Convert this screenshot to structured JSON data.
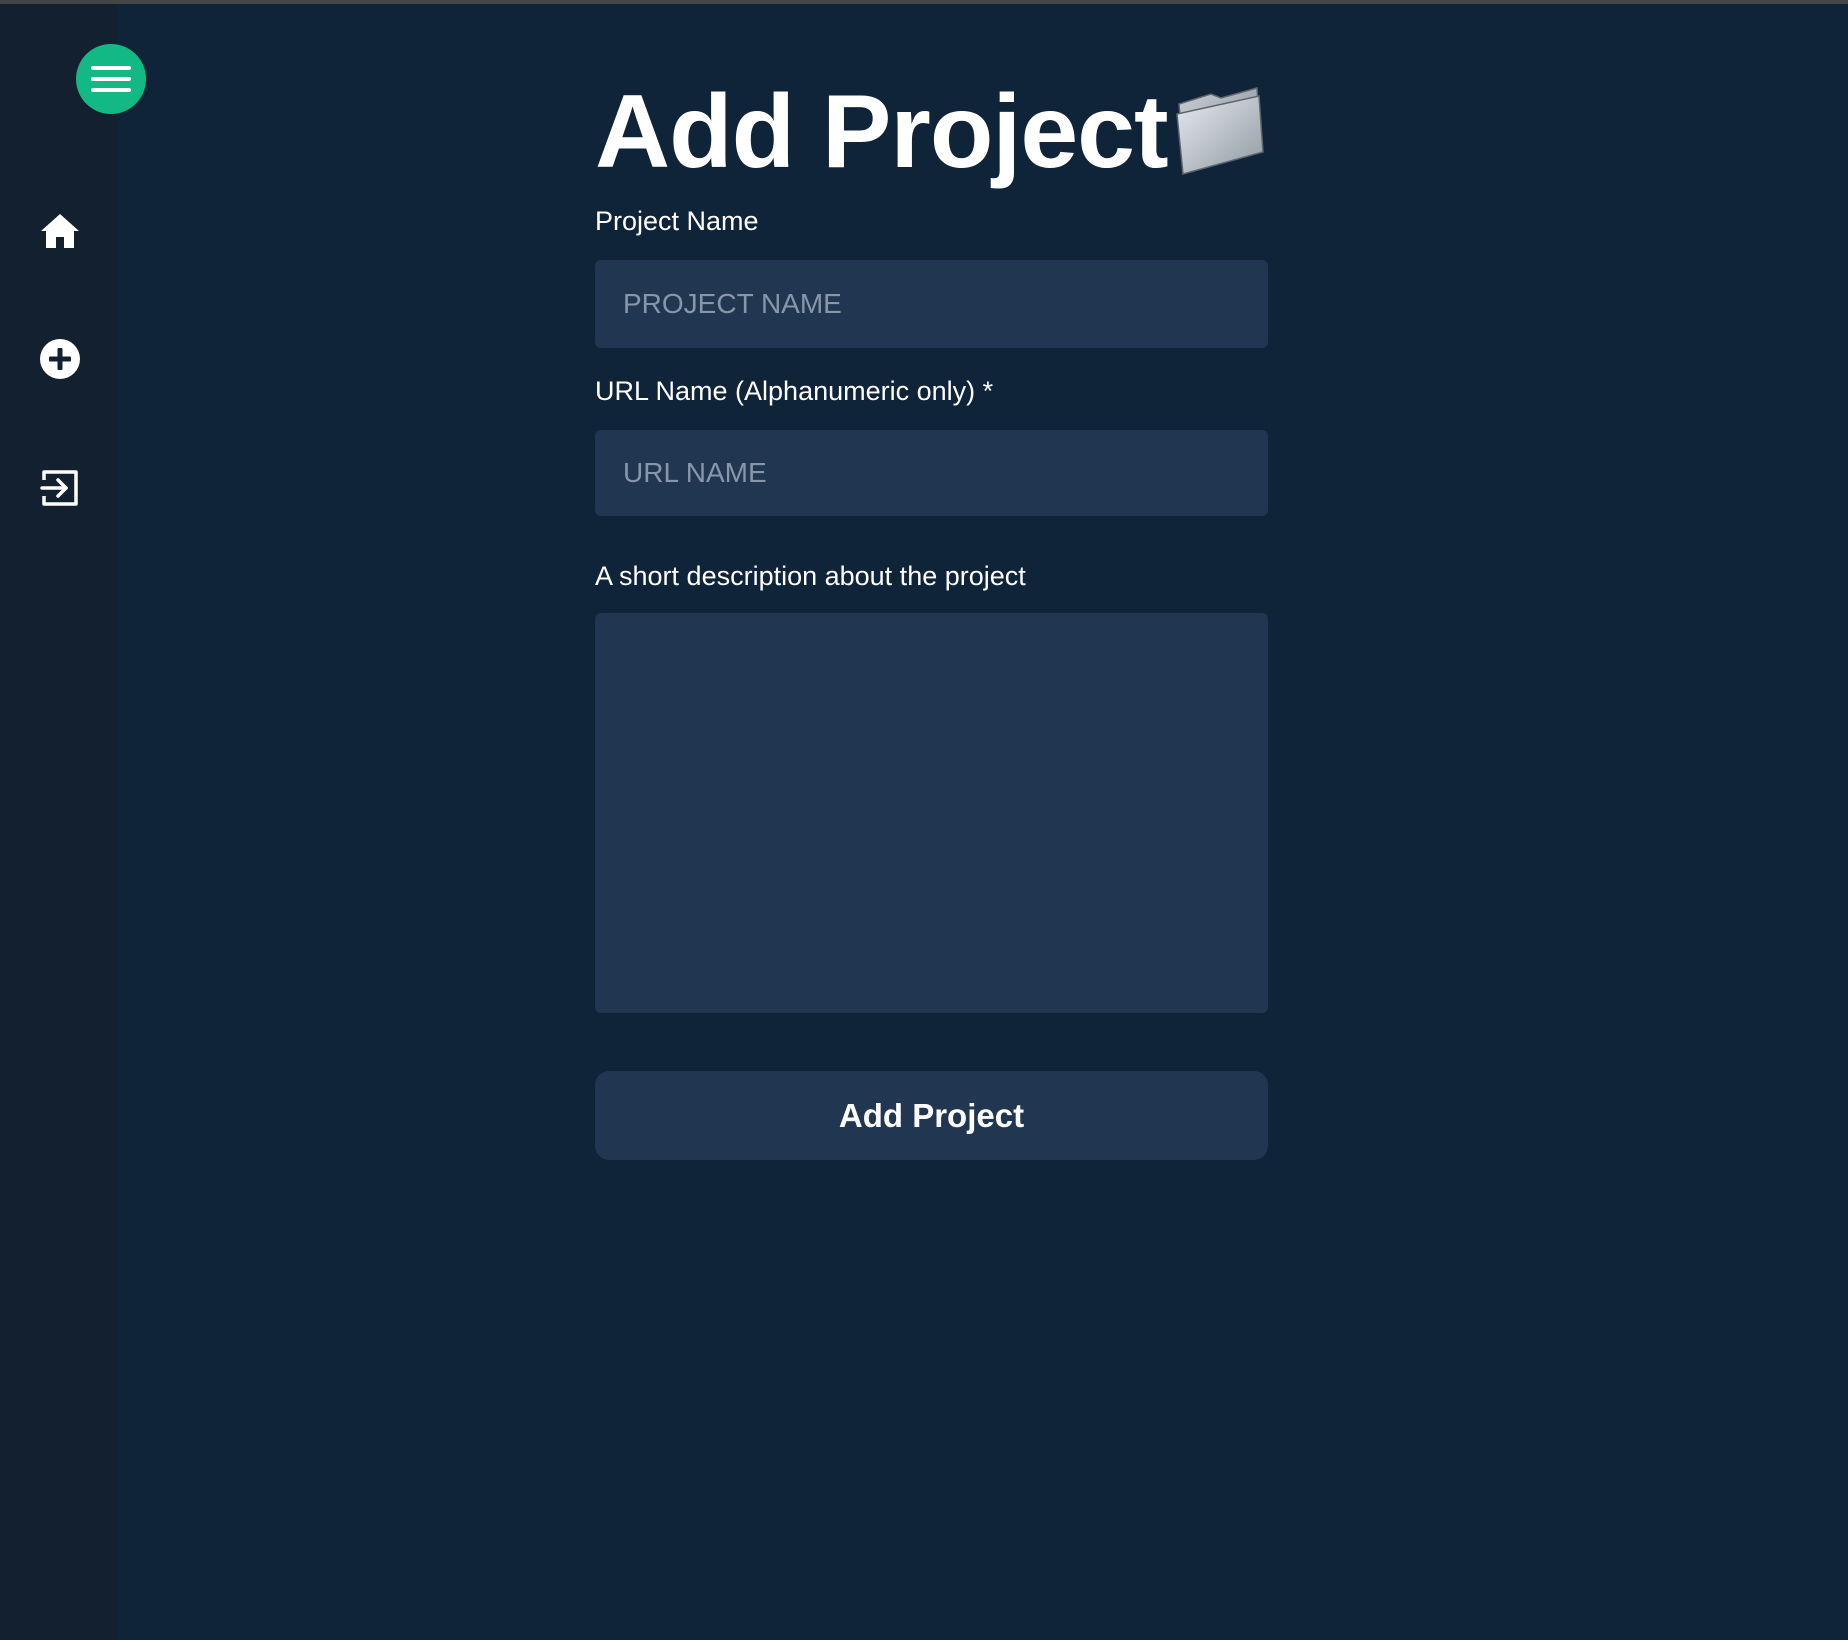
{
  "colors": {
    "background": "#0f2339",
    "sidebar": "#13202f",
    "accent": "#13b985",
    "field": "#213650",
    "placeholder": "#8797aa",
    "text": "#ffffff"
  },
  "sidebar": {
    "menu_icon": "hamburger-menu-icon",
    "items": [
      {
        "icon": "home-icon"
      },
      {
        "icon": "plus-circle-icon"
      },
      {
        "icon": "sign-in-icon"
      }
    ]
  },
  "main": {
    "title": "Add Project",
    "title_icon": "folder-icon",
    "project_name": {
      "label": "Project Name",
      "placeholder": "PROJECT NAME",
      "value": ""
    },
    "url_name": {
      "label": "URL Name (Alphanumeric only) *",
      "placeholder": "URL NAME",
      "value": ""
    },
    "description": {
      "label": "A short description about the project",
      "value": ""
    },
    "submit_label": "Add Project"
  }
}
